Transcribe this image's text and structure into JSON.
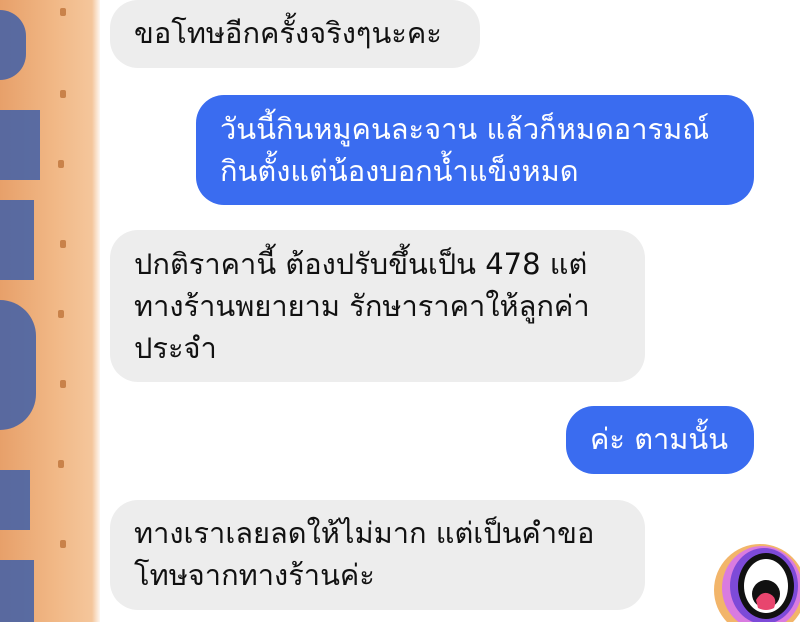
{
  "messages": [
    {
      "sender": "shop",
      "text": "ขอโทษอีกครั้งจริงๆนะคะ"
    },
    {
      "sender": "me",
      "text": "วันนี้กินหมูคนละจาน แล้วก็หมดอารมณ์\nกินตั้งแต่น้องบอกน้ำแข็งหมด"
    },
    {
      "sender": "shop",
      "text": "ปกติราคานี้ ต้องปรับขึ้นเป็น 478 แต่\nทางร้านพยายาม รักษาราคาให้ลูกค่า\nประจำ"
    },
    {
      "sender": "me",
      "text": "ค่ะ ตามนั้น"
    },
    {
      "sender": "shop",
      "text": "ทางเราเลยลดให้ไม่มาก แต่เป็นคำขอ\nโทษจากทางร้านค่ะ"
    }
  ],
  "colors": {
    "incoming_bubble": "#ededed",
    "outgoing_bubble": "#3a6cf0"
  },
  "sticker": {
    "icon": "screaming-mouth-sticker-icon"
  }
}
